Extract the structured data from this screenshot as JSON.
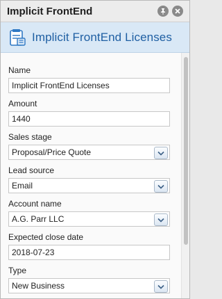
{
  "window": {
    "title": "Implicit FrontEnd"
  },
  "header": {
    "title": "Implicit FrontEnd Licenses",
    "icon": "record-icon"
  },
  "fields": [
    {
      "label": "Name",
      "value": "Implicit FrontEnd Licenses",
      "kind": "text"
    },
    {
      "label": "Amount",
      "value": "1440",
      "kind": "text"
    },
    {
      "label": "Sales stage",
      "value": "Proposal/Price Quote",
      "kind": "select"
    },
    {
      "label": "Lead source",
      "value": "Email",
      "kind": "select"
    },
    {
      "label": "Account name",
      "value": "A.G. Parr LLC",
      "kind": "select"
    },
    {
      "label": "Expected close date",
      "value": "2018-07-23",
      "kind": "text"
    },
    {
      "label": "Type",
      "value": "New Business",
      "kind": "select"
    }
  ],
  "colors": {
    "accent": "#1f5fa3",
    "header_bg": "#d9e8f6"
  }
}
